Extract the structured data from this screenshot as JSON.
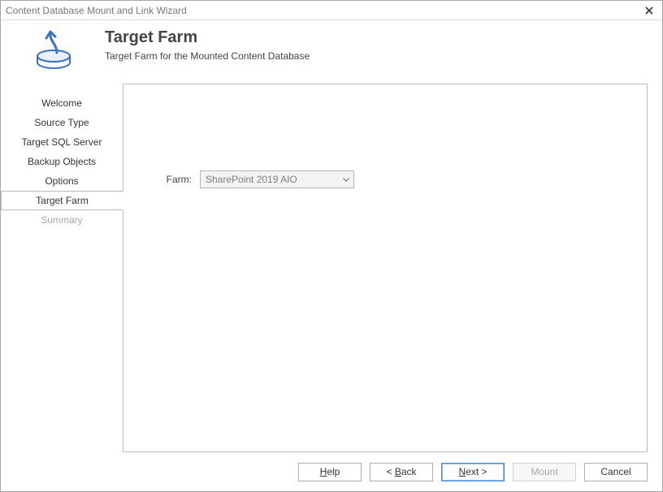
{
  "window": {
    "title": "Content Database Mount and Link Wizard"
  },
  "header": {
    "title": "Target Farm",
    "subtitle": "Target Farm for the Mounted Content Database"
  },
  "sidebar": {
    "items": [
      {
        "label": "Welcome",
        "state": "normal"
      },
      {
        "label": "Source Type",
        "state": "normal"
      },
      {
        "label": "Target SQL Server",
        "state": "normal"
      },
      {
        "label": "Backup Objects",
        "state": "normal"
      },
      {
        "label": "Options",
        "state": "normal"
      },
      {
        "label": "Target Farm",
        "state": "active"
      },
      {
        "label": "Summary",
        "state": "disabled"
      }
    ]
  },
  "form": {
    "farm_label": "Farm:",
    "farm_value": "SharePoint 2019 AIO"
  },
  "footer": {
    "help_prefix": "H",
    "help_rest": "elp",
    "back_prefix": "< ",
    "back_mn": "B",
    "back_rest": "ack",
    "next_mn": "N",
    "next_rest": "ext >",
    "mount_label": "Mount",
    "cancel_label": "Cancel"
  }
}
